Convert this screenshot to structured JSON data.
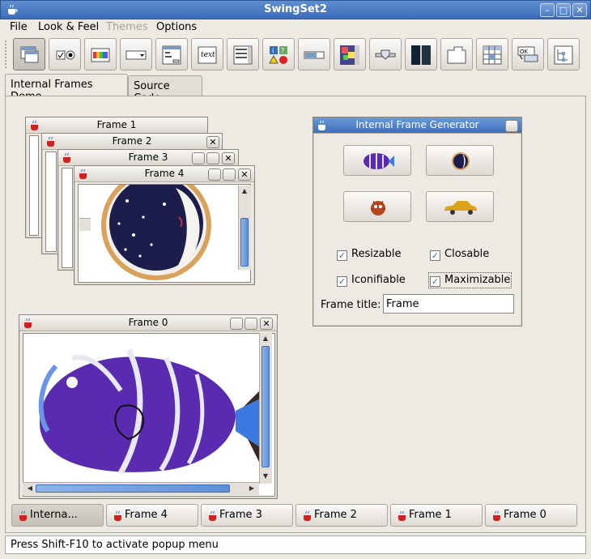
{
  "window": {
    "title": "SwingSet2"
  },
  "menubar": {
    "items": [
      {
        "label": "File",
        "enabled": true
      },
      {
        "label": "Look & Feel",
        "enabled": true
      },
      {
        "label": "Themes",
        "enabled": false
      },
      {
        "label": "Options",
        "enabled": true
      }
    ]
  },
  "toolbar": {
    "items": [
      "internal-frames-demo-icon",
      "checkbox-radio-icon",
      "file-chooser-icon",
      "color-chooser-icon",
      "combobox-icon",
      "dialog-icon",
      "editor-pane-icon",
      "list-icon",
      "option-pane-icon",
      "progress-bar-icon",
      "scroll-pane-icon",
      "slider-icon",
      "split-pane-icon",
      "tabbed-pane-icon",
      "table-icon",
      "tooltip-icon",
      "tree-icon"
    ]
  },
  "tabs": [
    {
      "label": "Internal Frames Demo",
      "selected": true
    },
    {
      "label": "Source Code",
      "selected": false
    }
  ],
  "frames": {
    "f1": {
      "title": "Frame 1"
    },
    "f2": {
      "title": "Frame 2"
    },
    "f3": {
      "title": "Frame 3"
    },
    "f4": {
      "title": "Frame 4"
    },
    "f0": {
      "title": "Frame 0"
    }
  },
  "generator": {
    "title": "Internal Frame Generator",
    "buttons": [
      "fish-icon",
      "moon-icon",
      "bug-icon",
      "car-icon"
    ],
    "resizable": {
      "label": "Resizable",
      "checked": true
    },
    "closable": {
      "label": "Closable",
      "checked": true
    },
    "iconifiable": {
      "label": "Iconifiable",
      "checked": true
    },
    "maximizable": {
      "label": "Maximizable",
      "checked": true
    },
    "frame_title_label": "Frame title:",
    "frame_title_value": "Frame"
  },
  "taskbar": [
    {
      "label": "Interna...",
      "selected": true
    },
    {
      "label": "Frame 4",
      "selected": false
    },
    {
      "label": "Frame 3",
      "selected": false
    },
    {
      "label": "Frame 2",
      "selected": false
    },
    {
      "label": "Frame 1",
      "selected": false
    },
    {
      "label": "Frame 0",
      "selected": false
    }
  ],
  "status": "Press Shift-F10 to activate popup menu",
  "colors": {
    "accent": "#3a6cb8",
    "background": "#ede9e3"
  }
}
